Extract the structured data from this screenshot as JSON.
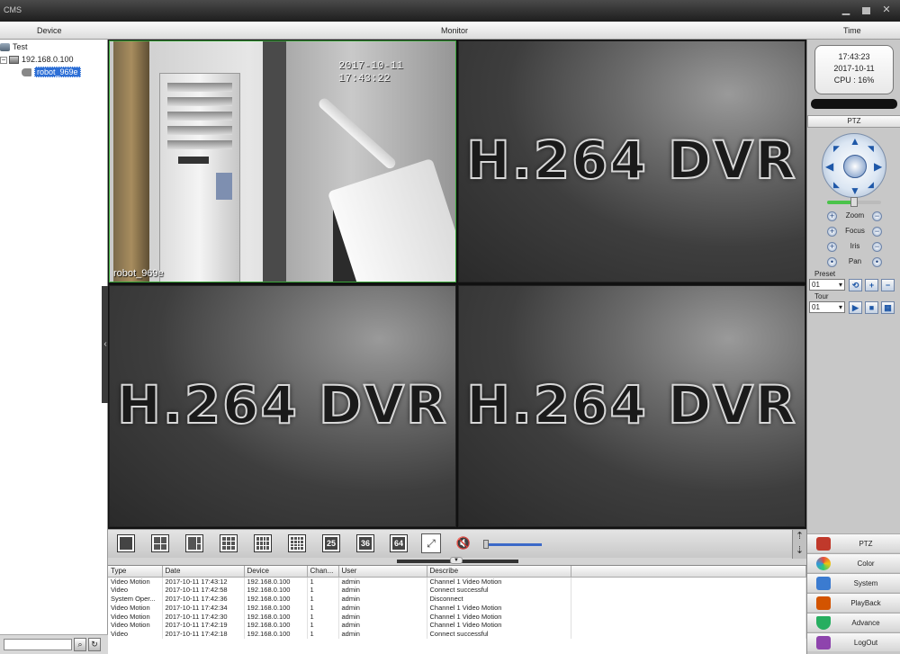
{
  "window": {
    "title": "CMS",
    "min_icon": "minimize-icon",
    "max_icon": "maximize-icon",
    "close_icon": "close-icon"
  },
  "header": {
    "device": "Device",
    "monitor": "Monitor",
    "time": "Time"
  },
  "device_tree": {
    "root": "Test",
    "dvr": "192.168.0.100",
    "camera": "robot_969e",
    "search_icon": "search-icon",
    "refresh_icon": "refresh-icon"
  },
  "monitor": {
    "camera_timestamp": "2017-10-11  17:43:22",
    "camera_name": "robot_969e",
    "placeholder_text": "H.264 DVR"
  },
  "clock": {
    "time": "17:43:23",
    "date": "2017-10-11",
    "cpu": "CPU : 16%"
  },
  "ptz": {
    "title": "PTZ",
    "controls": [
      {
        "label": "Zoom",
        "left": "+",
        "right": "−"
      },
      {
        "label": "Focus",
        "left": "+",
        "right": "−"
      },
      {
        "label": "Iris",
        "left": "+",
        "right": "−"
      },
      {
        "label": "Pan",
        "left": "•",
        "right": "•"
      }
    ],
    "preset_label": "Preset",
    "preset_value": "01",
    "tour_label": "Tour",
    "tour_value": "01"
  },
  "nav": [
    {
      "label": "PTZ",
      "icon": "ptz-icon",
      "color": "#c0392b"
    },
    {
      "label": "Color",
      "icon": "color-icon",
      "color": "#e67e22"
    },
    {
      "label": "System",
      "icon": "system-icon",
      "color": "#3b7bd0"
    },
    {
      "label": "PlayBack",
      "icon": "playback-icon",
      "color": "#d35400"
    },
    {
      "label": "Advance",
      "icon": "advance-icon",
      "color": "#27ae60"
    },
    {
      "label": "LogOut",
      "icon": "logout-icon",
      "color": "#8e44ad"
    }
  ],
  "layouts": [
    {
      "name": "layout-1",
      "label": ""
    },
    {
      "name": "layout-4",
      "label": ""
    },
    {
      "name": "layout-6",
      "label": ""
    },
    {
      "name": "layout-9",
      "label": ""
    },
    {
      "name": "layout-12",
      "label": ""
    },
    {
      "name": "layout-16",
      "label": ""
    },
    {
      "name": "layout-25",
      "label": "25"
    },
    {
      "name": "layout-36",
      "label": "36"
    },
    {
      "name": "layout-64",
      "label": "64"
    }
  ],
  "log": {
    "columns": [
      "Type",
      "Date",
      "Device",
      "Chan...",
      "User",
      "Describe"
    ],
    "rows": [
      [
        "Video Motion",
        "2017-10-11 17:43:12",
        "192.168.0.100",
        "1",
        "admin",
        "Channel 1 Video Motion"
      ],
      [
        "Video",
        "2017-10-11 17:42:58",
        "192.168.0.100",
        "1",
        "admin",
        "Connect successful"
      ],
      [
        "System Oper...",
        "2017-10-11 17:42:36",
        "192.168.0.100",
        "1",
        "admin",
        "Disconnect"
      ],
      [
        "Video Motion",
        "2017-10-11 17:42:34",
        "192.168.0.100",
        "1",
        "admin",
        "Channel 1 Video Motion"
      ],
      [
        "Video Motion",
        "2017-10-11 17:42:30",
        "192.168.0.100",
        "1",
        "admin",
        "Channel 1 Video Motion"
      ],
      [
        "Video Motion",
        "2017-10-11 17:42:19",
        "192.168.0.100",
        "1",
        "admin",
        "Channel 1 Video Motion"
      ],
      [
        "Video",
        "2017-10-11 17:42:18",
        "192.168.0.100",
        "1",
        "admin",
        "Connect successful"
      ]
    ]
  }
}
